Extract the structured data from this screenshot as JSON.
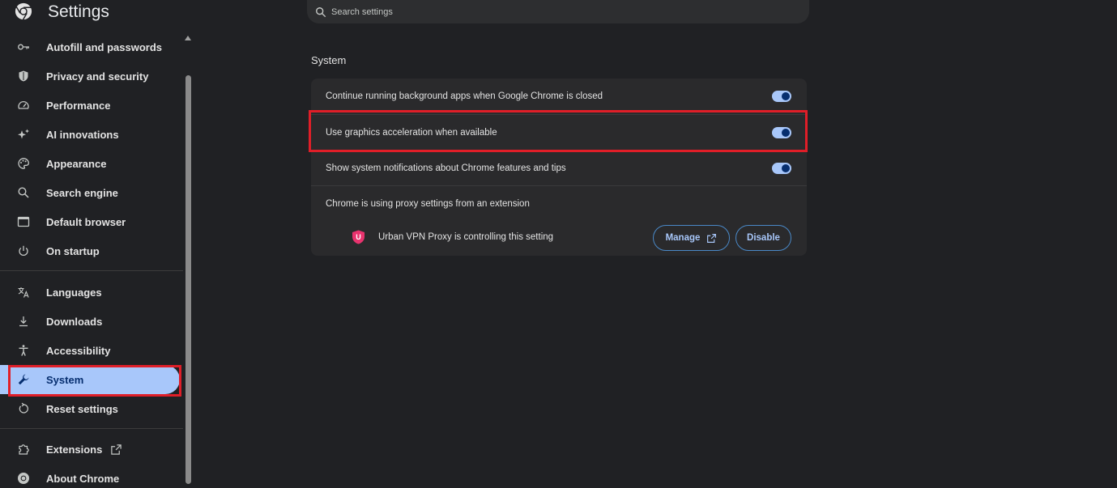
{
  "header": {
    "title": "Settings",
    "logo_icon": "chrome-logo-icon"
  },
  "search": {
    "placeholder": "Search settings"
  },
  "sidebar": {
    "items": [
      {
        "label": "Autofill and passwords",
        "icon": "key-icon"
      },
      {
        "label": "Privacy and security",
        "icon": "shield-icon"
      },
      {
        "label": "Performance",
        "icon": "speedometer-icon"
      },
      {
        "label": "AI innovations",
        "icon": "sparkle-icon"
      },
      {
        "label": "Appearance",
        "icon": "palette-icon"
      },
      {
        "label": "Search engine",
        "icon": "search-icon"
      },
      {
        "label": "Default browser",
        "icon": "browser-window-icon"
      },
      {
        "label": "On startup",
        "icon": "power-icon"
      },
      {
        "label": "Languages",
        "icon": "translate-icon"
      },
      {
        "label": "Downloads",
        "icon": "download-icon"
      },
      {
        "label": "Accessibility",
        "icon": "accessibility-icon"
      },
      {
        "label": "System",
        "icon": "wrench-icon",
        "active": true
      },
      {
        "label": "Reset settings",
        "icon": "reset-icon"
      },
      {
        "label": "Extensions",
        "icon": "puzzle-icon"
      },
      {
        "label": "About Chrome",
        "icon": "chrome-icon"
      }
    ]
  },
  "main": {
    "section_title": "System",
    "rows": [
      {
        "label": "Continue running background apps when Google Chrome is closed",
        "toggle": true
      },
      {
        "label": "Use graphics acceleration when available",
        "toggle": true
      },
      {
        "label": "Show system notifications about Chrome features and tips",
        "toggle": true
      },
      {
        "label": "Chrome is using proxy settings from an extension"
      }
    ],
    "extension": {
      "label": "Urban VPN Proxy is controlling this setting",
      "badge_letter": "U",
      "manage_label": "Manage",
      "disable_label": "Disable"
    }
  },
  "colors": {
    "background": "#202124",
    "accent": "#a8c7fa",
    "highlight": "#e01e28",
    "card": "#2a2a2c"
  }
}
